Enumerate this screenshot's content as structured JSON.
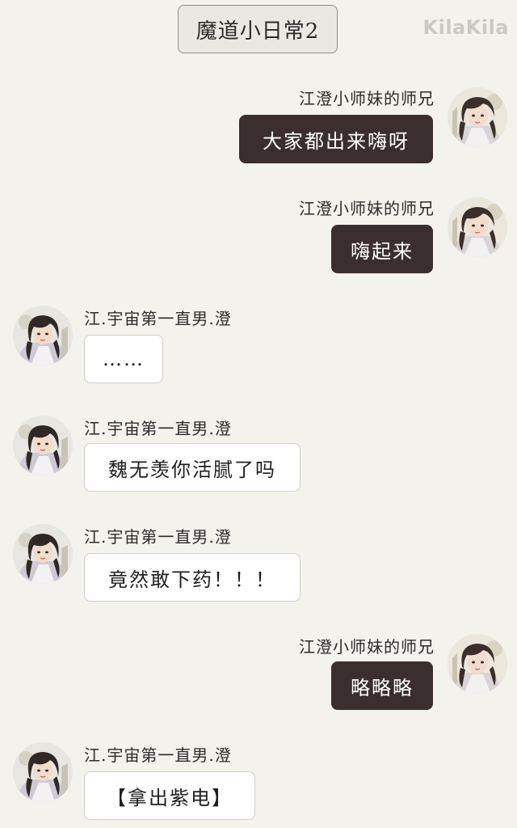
{
  "header": {
    "title": "魔道小日常2",
    "watermark": "KilaKila"
  },
  "messages": [
    {
      "side": "right",
      "sender": "江澄小师妹的师兄",
      "text": "大家都出来嗨呀"
    },
    {
      "side": "right",
      "sender": "江澄小师妹的师兄",
      "text": "嗨起来"
    },
    {
      "side": "left",
      "sender": "江.宇宙第一直男.澄",
      "text": "……"
    },
    {
      "side": "left",
      "sender": "江.宇宙第一直男.澄",
      "text": "魏无羡你活腻了吗"
    },
    {
      "side": "left",
      "sender": "江.宇宙第一直男.澄",
      "text": "竟然敢下药！！！"
    },
    {
      "side": "right",
      "sender": "江澄小师妹的师兄",
      "text": "略略略"
    },
    {
      "side": "left",
      "sender": "江.宇宙第一直男.澄",
      "text": "【拿出紫电】"
    }
  ]
}
